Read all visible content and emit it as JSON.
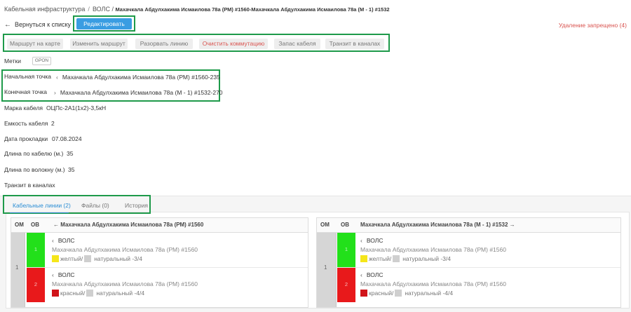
{
  "breadcrumb": {
    "root": "Кабельная инфраструктура",
    "section": "ВОЛС /",
    "current": "Махачкала Абдулхакима Исмаилова 78а (РМ) #1560-Махачкала Абдулхакима Исмаилова 78а (М - 1) #1532"
  },
  "header": {
    "back_label": "Вернуться к списку",
    "edit_label": "Редактировать",
    "delete_forbidden": "Удаление запрещено (4)"
  },
  "actions": [
    {
      "label": "Маршрут на карте",
      "style": "normal"
    },
    {
      "label": "Изменить маршрут",
      "style": "normal"
    },
    {
      "label": "Разорвать линию",
      "style": "normal"
    },
    {
      "label": "Очистить коммутацию",
      "style": "danger"
    },
    {
      "label": "Запас кабеля",
      "style": "normal"
    },
    {
      "label": "Транзит в каналах",
      "style": "normal"
    }
  ],
  "props": {
    "tags_label": "Метки",
    "tag": "GPON",
    "start_label": "Начальная точка",
    "start_value": "Махачкала Абдулхакима Исмаилова 78а (РМ) #1560-235",
    "end_label": "Конечная точка",
    "end_value": "Махачкала Абдулхакима Исмаилова 78а (М - 1) #1532-270",
    "brand_label": "Марка кабеля",
    "brand_value": "ОЦПс-2А1(1х2)-3,5кН",
    "capacity_label": "Емкость кабеля",
    "capacity_value": "2",
    "date_label": "Дата прокладки",
    "date_value": "07.08.2024",
    "cable_len_label": "Длина по кабелю (м.)",
    "cable_len_value": "35",
    "fiber_len_label": "Длина по волокну (м.)",
    "fiber_len_value": "35",
    "transit_label": "Транзит в каналах"
  },
  "tabs": [
    {
      "label": "Кабельные линии (2)",
      "active": true
    },
    {
      "label": "Файлы (0)",
      "active": false
    },
    {
      "label": "История",
      "active": false
    }
  ],
  "tables": [
    {
      "om_header": "ОМ",
      "ov_header": "ОВ",
      "title": "← Махачкала Абдулхакима Исмаилова 78а (РМ) #1560",
      "om_value": "1",
      "rows": [
        {
          "fiber_num": "1",
          "fiber_color": "#22e01a",
          "type": "ВОЛС",
          "addr": "Махачкала Абдулхакима Исмаилова 78а (РМ) #1560",
          "c1_color": "#f5e61a",
          "c1_label": "желтый/",
          "c2_label": "натуральный -3/4"
        },
        {
          "fiber_num": "2",
          "fiber_color": "#e8191b",
          "type": "ВОЛС",
          "addr": "Махачкала Абдулхакима Исмаилова 78а (РМ) #1560",
          "c1_color": "#d0141a",
          "c1_label": "красный/",
          "c2_label": "натуральный -4/4"
        }
      ]
    },
    {
      "om_header": "ОМ",
      "ov_header": "ОВ",
      "title": "Махачкала Абдулхакима Исмаилова 78а (М - 1) #1532 →",
      "om_value": "1",
      "rows": [
        {
          "fiber_num": "1",
          "fiber_color": "#22e01a",
          "type": "ВОЛС",
          "addr": "Махачкала Абдулхакима Исмаилова 78а (РМ) #1560",
          "c1_color": "#f5e61a",
          "c1_label": "желтый/",
          "c2_label": "натуральный -3/4"
        },
        {
          "fiber_num": "2",
          "fiber_color": "#e8191b",
          "type": "ВОЛС",
          "addr": "Махачкала Абдулхакима Исмаилова 78а (РМ) #1560",
          "c1_color": "#d0141a",
          "c1_label": "красный/",
          "c2_label": "натуральный -4/4"
        }
      ]
    }
  ]
}
